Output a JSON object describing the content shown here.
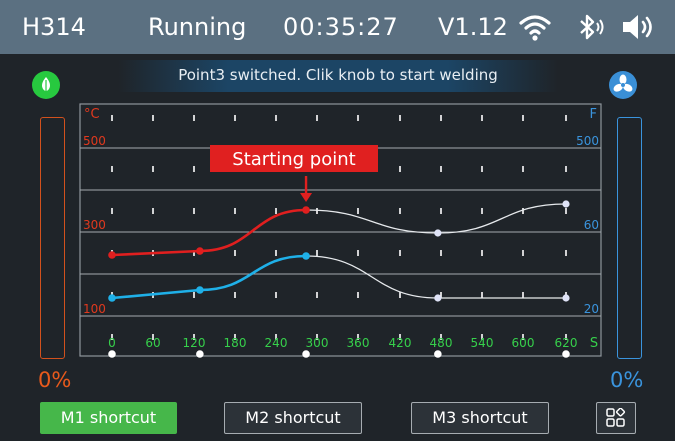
{
  "status_bar": {
    "model": "H314",
    "state": "Running",
    "timer": "00:35:27",
    "version": "V1.12",
    "icons": [
      "wifi-icon",
      "bluetooth-icon",
      "speaker-icon"
    ]
  },
  "banner": {
    "message": "Point3 switched. Clik knob to start welding"
  },
  "left_gauge": {
    "percent_label": "0%",
    "level": 0,
    "color": "#d2511d"
  },
  "right_gauge": {
    "percent_label": "0%",
    "level": 0,
    "color": "#3a94dd"
  },
  "indicators": {
    "left": "drop-icon",
    "right": "fan-icon"
  },
  "callout": {
    "label": "Starting point",
    "color": "#e02020"
  },
  "chart_data": {
    "type": "line",
    "x_ticks": [
      "0",
      "60",
      "120",
      "180",
      "240",
      "300",
      "360",
      "420",
      "480",
      "540",
      "600",
      "620"
    ],
    "x_unit": "S",
    "left_axis": {
      "unit": "°C",
      "ticks": [
        "500",
        "300",
        "100"
      ]
    },
    "right_axis": {
      "unit": "F",
      "ticks": [
        "500",
        "60",
        "20"
      ]
    },
    "grid": true,
    "series": [
      {
        "color": "#e01f1f",
        "active_color": "#e01f1f",
        "points": [
          [
            0,
            250
          ],
          [
            120,
            260
          ],
          [
            265,
            355
          ],
          [
            445,
            305
          ],
          [
            620,
            360
          ]
        ],
        "active_until": 2
      },
      {
        "color": "#1fb0e8",
        "active_color": "#1fb0e8",
        "points": [
          [
            0,
            150
          ],
          [
            120,
            170
          ],
          [
            265,
            220
          ],
          [
            445,
            150
          ],
          [
            620,
            150
          ]
        ],
        "active_until": 2
      }
    ],
    "segment_markers_x": [
      0,
      120,
      265,
      445,
      620
    ]
  },
  "buttons": {
    "m1": "M1 shortcut",
    "m2": "M2 shortcut",
    "m3": "M3 shortcut",
    "grid_icon": "apps-grid-icon"
  }
}
